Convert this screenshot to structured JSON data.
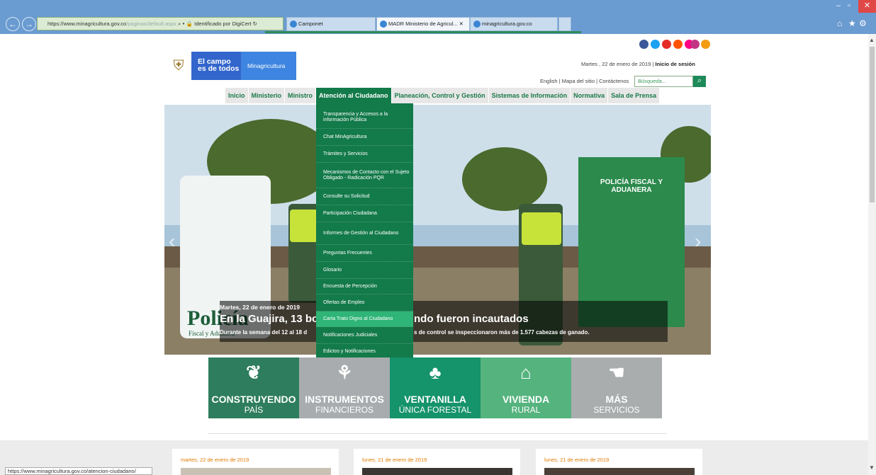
{
  "browser": {
    "url_host": "https://www.minagricultura.gov.co",
    "url_path": "/paginas/default.aspx",
    "cert": "Identificado por DigiCert",
    "tabs": [
      "Camponet",
      "MADR Ministerio de Agricul...",
      "minagricultura.gov.co"
    ],
    "status_url": "https://www.minagricultura.gov.co/atencion-ciudadano/"
  },
  "header": {
    "logo_line1": "El campo",
    "logo_line2": "es de todos",
    "logo_brand": "Minagricultura",
    "date": "Martes , 22 de enero de 2019",
    "login": "Inicio de sesión",
    "links": [
      "English",
      "Mapa del sitio",
      "Contáctenos"
    ],
    "search_placeholder": "Búsqueda..."
  },
  "nav": [
    "Inicio",
    "Ministerio",
    "Ministro",
    "Atención al Ciudadano",
    "Planeación, Control y Gestión",
    "Sistemas de Información",
    "Normativa",
    "Sala de Prensa"
  ],
  "dropdown": [
    "Transparencia y Accesos a la información Pública",
    "Chat MinAgricultura",
    "Trámites y Servicios",
    "Mecanismos de Contacto con el Sujeto Obligado - Radicación PQR",
    "Consulte su Solicitud",
    "Participación Ciudadana",
    "Informes de Gestión al Ciudadano",
    "Preguntas Frecuentes",
    "Glosario",
    "Encuesta de Percepción",
    "Ofertas de Empleo",
    "Carta Trato Digno al Ciudadano",
    "Notificaciones Judiciales",
    "Edictos y Notificaciones"
  ],
  "hero": {
    "date": "Martes, 22 de enero de 2019",
    "title_left": "En la Guajira, 13 bo",
    "title_right": "ndo fueron incautados",
    "sub_left": "Durante la semana del 12 al 18 d",
    "sub_right": "s de control se inspeccionaron más de 1.577 cabezas de ganado.",
    "banner_text": "Policía",
    "banner_sub": "Fiscal y Aduanera",
    "banner2_text": "POLICÍA FISCAL Y ADUANERA"
  },
  "tiles": [
    {
      "t1": "CONSTRUYENDO",
      "t2": "PAÍS",
      "color": "#2e7d5e"
    },
    {
      "t1": "INSTRUMENTOS",
      "t2": "FINANCIEROS",
      "color": "#a8acae"
    },
    {
      "t1": "VENTANILLA",
      "t2": "ÚNICA FORESTAL",
      "color": "#15936a"
    },
    {
      "t1": "VIVIENDA",
      "t2": "RURAL",
      "color": "#55b37e"
    },
    {
      "t1": "MÁS",
      "t2": "SERVICIOS",
      "color": "#a9adae"
    }
  ],
  "news_dates": [
    "martes, 22 de enero de 2019",
    "lunes, 21 de enero de 2019",
    "lunes, 21 de enero de 2019"
  ]
}
